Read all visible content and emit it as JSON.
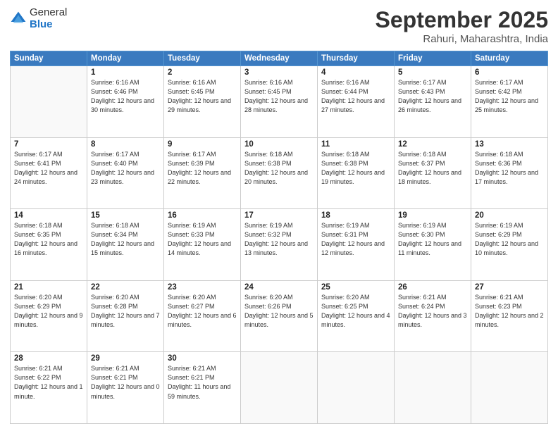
{
  "logo": {
    "general": "General",
    "blue": "Blue"
  },
  "header": {
    "month": "September 2025",
    "location": "Rahuri, Maharashtra, India"
  },
  "weekdays": [
    "Sunday",
    "Monday",
    "Tuesday",
    "Wednesday",
    "Thursday",
    "Friday",
    "Saturday"
  ],
  "weeks": [
    [
      {
        "day": "",
        "info": ""
      },
      {
        "day": "1",
        "info": "Sunrise: 6:16 AM\nSunset: 6:46 PM\nDaylight: 12 hours\nand 30 minutes."
      },
      {
        "day": "2",
        "info": "Sunrise: 6:16 AM\nSunset: 6:45 PM\nDaylight: 12 hours\nand 29 minutes."
      },
      {
        "day": "3",
        "info": "Sunrise: 6:16 AM\nSunset: 6:45 PM\nDaylight: 12 hours\nand 28 minutes."
      },
      {
        "day": "4",
        "info": "Sunrise: 6:16 AM\nSunset: 6:44 PM\nDaylight: 12 hours\nand 27 minutes."
      },
      {
        "day": "5",
        "info": "Sunrise: 6:17 AM\nSunset: 6:43 PM\nDaylight: 12 hours\nand 26 minutes."
      },
      {
        "day": "6",
        "info": "Sunrise: 6:17 AM\nSunset: 6:42 PM\nDaylight: 12 hours\nand 25 minutes."
      }
    ],
    [
      {
        "day": "7",
        "info": "Sunrise: 6:17 AM\nSunset: 6:41 PM\nDaylight: 12 hours\nand 24 minutes."
      },
      {
        "day": "8",
        "info": "Sunrise: 6:17 AM\nSunset: 6:40 PM\nDaylight: 12 hours\nand 23 minutes."
      },
      {
        "day": "9",
        "info": "Sunrise: 6:17 AM\nSunset: 6:39 PM\nDaylight: 12 hours\nand 22 minutes."
      },
      {
        "day": "10",
        "info": "Sunrise: 6:18 AM\nSunset: 6:38 PM\nDaylight: 12 hours\nand 20 minutes."
      },
      {
        "day": "11",
        "info": "Sunrise: 6:18 AM\nSunset: 6:38 PM\nDaylight: 12 hours\nand 19 minutes."
      },
      {
        "day": "12",
        "info": "Sunrise: 6:18 AM\nSunset: 6:37 PM\nDaylight: 12 hours\nand 18 minutes."
      },
      {
        "day": "13",
        "info": "Sunrise: 6:18 AM\nSunset: 6:36 PM\nDaylight: 12 hours\nand 17 minutes."
      }
    ],
    [
      {
        "day": "14",
        "info": "Sunrise: 6:18 AM\nSunset: 6:35 PM\nDaylight: 12 hours\nand 16 minutes."
      },
      {
        "day": "15",
        "info": "Sunrise: 6:18 AM\nSunset: 6:34 PM\nDaylight: 12 hours\nand 15 minutes."
      },
      {
        "day": "16",
        "info": "Sunrise: 6:19 AM\nSunset: 6:33 PM\nDaylight: 12 hours\nand 14 minutes."
      },
      {
        "day": "17",
        "info": "Sunrise: 6:19 AM\nSunset: 6:32 PM\nDaylight: 12 hours\nand 13 minutes."
      },
      {
        "day": "18",
        "info": "Sunrise: 6:19 AM\nSunset: 6:31 PM\nDaylight: 12 hours\nand 12 minutes."
      },
      {
        "day": "19",
        "info": "Sunrise: 6:19 AM\nSunset: 6:30 PM\nDaylight: 12 hours\nand 11 minutes."
      },
      {
        "day": "20",
        "info": "Sunrise: 6:19 AM\nSunset: 6:29 PM\nDaylight: 12 hours\nand 10 minutes."
      }
    ],
    [
      {
        "day": "21",
        "info": "Sunrise: 6:20 AM\nSunset: 6:29 PM\nDaylight: 12 hours\nand 9 minutes."
      },
      {
        "day": "22",
        "info": "Sunrise: 6:20 AM\nSunset: 6:28 PM\nDaylight: 12 hours\nand 7 minutes."
      },
      {
        "day": "23",
        "info": "Sunrise: 6:20 AM\nSunset: 6:27 PM\nDaylight: 12 hours\nand 6 minutes."
      },
      {
        "day": "24",
        "info": "Sunrise: 6:20 AM\nSunset: 6:26 PM\nDaylight: 12 hours\nand 5 minutes."
      },
      {
        "day": "25",
        "info": "Sunrise: 6:20 AM\nSunset: 6:25 PM\nDaylight: 12 hours\nand 4 minutes."
      },
      {
        "day": "26",
        "info": "Sunrise: 6:21 AM\nSunset: 6:24 PM\nDaylight: 12 hours\nand 3 minutes."
      },
      {
        "day": "27",
        "info": "Sunrise: 6:21 AM\nSunset: 6:23 PM\nDaylight: 12 hours\nand 2 minutes."
      }
    ],
    [
      {
        "day": "28",
        "info": "Sunrise: 6:21 AM\nSunset: 6:22 PM\nDaylight: 12 hours\nand 1 minute."
      },
      {
        "day": "29",
        "info": "Sunrise: 6:21 AM\nSunset: 6:21 PM\nDaylight: 12 hours\nand 0 minutes."
      },
      {
        "day": "30",
        "info": "Sunrise: 6:21 AM\nSunset: 6:21 PM\nDaylight: 11 hours\nand 59 minutes."
      },
      {
        "day": "",
        "info": ""
      },
      {
        "day": "",
        "info": ""
      },
      {
        "day": "",
        "info": ""
      },
      {
        "day": "",
        "info": ""
      }
    ]
  ]
}
